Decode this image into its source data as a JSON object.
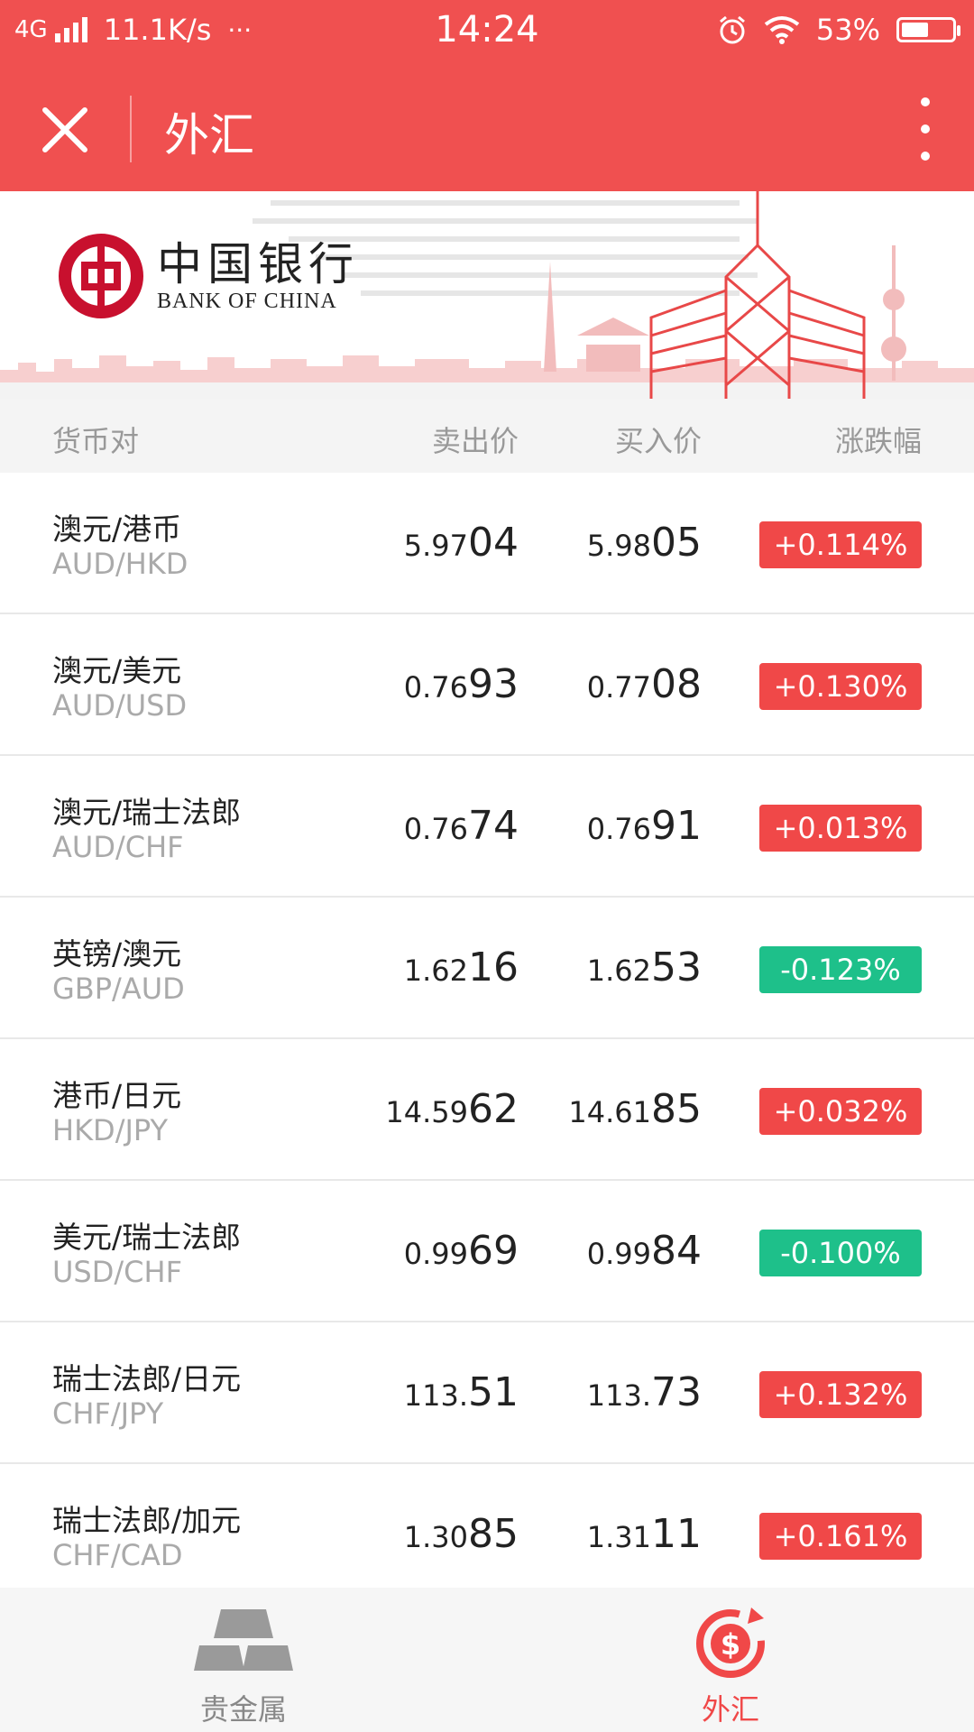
{
  "status_bar": {
    "network": "4G",
    "speed": "11.1K/s",
    "more": "···",
    "time": "14:24",
    "battery": "53%",
    "battery_level": 0.53
  },
  "titlebar": {
    "title": "外汇"
  },
  "banner": {
    "bank_name_cn": "中国银行",
    "bank_name_en": "BANK OF CHINA"
  },
  "table": {
    "headers": {
      "pair": "货币对",
      "sell": "卖出价",
      "buy": "买入价",
      "change": "涨跌幅"
    },
    "rows": [
      {
        "cn": "澳元/港币",
        "code": "AUD/HKD",
        "sell_a": "5.97",
        "sell_b": "04",
        "buy_a": "5.98",
        "buy_b": "05",
        "change": "+0.114%",
        "dir": "up"
      },
      {
        "cn": "澳元/美元",
        "code": "AUD/USD",
        "sell_a": "0.76",
        "sell_b": "93",
        "buy_a": "0.77",
        "buy_b": "08",
        "change": "+0.130%",
        "dir": "up"
      },
      {
        "cn": "澳元/瑞士法郎",
        "code": "AUD/CHF",
        "sell_a": "0.76",
        "sell_b": "74",
        "buy_a": "0.76",
        "buy_b": "91",
        "change": "+0.013%",
        "dir": "up"
      },
      {
        "cn": "英镑/澳元",
        "code": "GBP/AUD",
        "sell_a": "1.62",
        "sell_b": "16",
        "buy_a": "1.62",
        "buy_b": "53",
        "change": "-0.123%",
        "dir": "down"
      },
      {
        "cn": "港币/日元",
        "code": "HKD/JPY",
        "sell_a": "14.59",
        "sell_b": "62",
        "buy_a": "14.61",
        "buy_b": "85",
        "change": "+0.032%",
        "dir": "up"
      },
      {
        "cn": "美元/瑞士法郎",
        "code": "USD/CHF",
        "sell_a": "0.99",
        "sell_b": "69",
        "buy_a": "0.99",
        "buy_b": "84",
        "change": "-0.100%",
        "dir": "down"
      },
      {
        "cn": "瑞士法郎/日元",
        "code": "CHF/JPY",
        "sell_a": "113.",
        "sell_b": "51",
        "buy_a": "113.",
        "buy_b": "73",
        "change": "+0.132%",
        "dir": "up"
      },
      {
        "cn": "瑞士法郎/加元",
        "code": "CHF/CAD",
        "sell_a": "1.30",
        "sell_b": "85",
        "buy_a": "1.31",
        "buy_b": "11",
        "change": "+0.161%",
        "dir": "up"
      }
    ]
  },
  "tabbar": {
    "tabs": [
      {
        "label": "贵金属",
        "icon": "gold-bars-icon",
        "active": false
      },
      {
        "label": "外汇",
        "icon": "currency-exchange-icon",
        "active": true
      }
    ]
  },
  "colors": {
    "brand": "#f05050",
    "up": "#f04848",
    "down": "#1ec08a",
    "active_tab": "#f04848",
    "inactive_tab": "#888888"
  }
}
